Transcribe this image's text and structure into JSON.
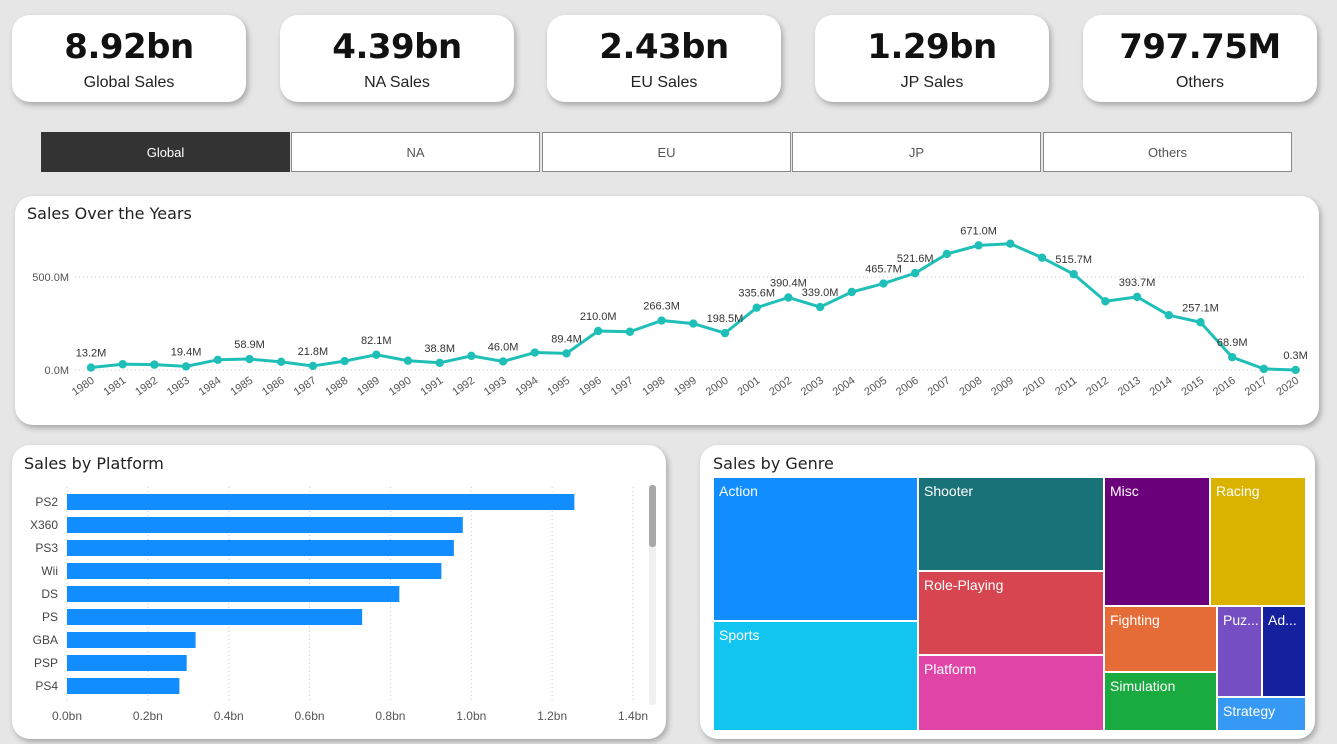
{
  "kpis": [
    {
      "value": "8.92bn",
      "label": "Global Sales"
    },
    {
      "value": "4.39bn",
      "label": "NA Sales"
    },
    {
      "value": "2.43bn",
      "label": "EU Sales"
    },
    {
      "value": "1.29bn",
      "label": "JP Sales"
    },
    {
      "value": "797.75M",
      "label": "Others"
    }
  ],
  "tabs": [
    {
      "label": "Global",
      "active": true
    },
    {
      "label": "NA",
      "active": false
    },
    {
      "label": "EU",
      "active": false
    },
    {
      "label": "JP",
      "active": false
    },
    {
      "label": "Others",
      "active": false
    }
  ],
  "colors": {
    "line": "#1fbfb8",
    "bar": "#118dff",
    "active_tab": "#333333"
  },
  "chart_data": [
    {
      "type": "line",
      "title": "Sales Over the Years",
      "x": [
        "1980",
        "1981",
        "1982",
        "1983",
        "1984",
        "1985",
        "1986",
        "1987",
        "1988",
        "1989",
        "1990",
        "1991",
        "1992",
        "1993",
        "1994",
        "1995",
        "1996",
        "1997",
        "1998",
        "1999",
        "2000",
        "2001",
        "2002",
        "2003",
        "2004",
        "2005",
        "2006",
        "2007",
        "2008",
        "2009",
        "2010",
        "2011",
        "2012",
        "2013",
        "2014",
        "2015",
        "2016",
        "2017",
        "2020"
      ],
      "values": [
        13.2,
        31,
        28.9,
        19.4,
        55,
        58.9,
        44,
        21.8,
        48,
        82.1,
        50,
        38.8,
        76,
        46.0,
        94,
        89.4,
        210.0,
        206,
        266.3,
        250,
        198.5,
        335.6,
        390.4,
        339.0,
        420,
        465.7,
        521.6,
        625,
        671.0,
        680,
        605,
        515.7,
        370,
        393.7,
        295,
        257.1,
        68.9,
        6,
        0.3
      ],
      "data_labels": [
        {
          "x": "1980",
          "text": "13.2M"
        },
        {
          "x": "1983",
          "text": "19.4M"
        },
        {
          "x": "1985",
          "text": "58.9M"
        },
        {
          "x": "1987",
          "text": "21.8M"
        },
        {
          "x": "1989",
          "text": "82.1M"
        },
        {
          "x": "1991",
          "text": "38.8M"
        },
        {
          "x": "1993",
          "text": "46.0M"
        },
        {
          "x": "1995",
          "text": "89.4M"
        },
        {
          "x": "1996",
          "text": "210.0M"
        },
        {
          "x": "1998",
          "text": "266.3M"
        },
        {
          "x": "2000",
          "text": "198.5M"
        },
        {
          "x": "2001",
          "text": "335.6M"
        },
        {
          "x": "2002",
          "text": "390.4M"
        },
        {
          "x": "2003",
          "text": "339.0M"
        },
        {
          "x": "2005",
          "text": "465.7M"
        },
        {
          "x": "2006",
          "text": "521.6M"
        },
        {
          "x": "2008",
          "text": "671.0M"
        },
        {
          "x": "2011",
          "text": "515.7M"
        },
        {
          "x": "2013",
          "text": "393.7M"
        },
        {
          "x": "2015",
          "text": "257.1M"
        },
        {
          "x": "2016",
          "text": "68.9M"
        },
        {
          "x": "2020",
          "text": "0.3M"
        }
      ],
      "ylim": [
        0,
        700
      ],
      "yticks": [
        {
          "value": 0,
          "label": "0.0M"
        },
        {
          "value": 500,
          "label": "500.0M"
        }
      ],
      "grid": true
    },
    {
      "type": "bar",
      "orientation": "horizontal",
      "title": "Sales by Platform",
      "categories": [
        "PS2",
        "X360",
        "PS3",
        "Wii",
        "DS",
        "PS",
        "GBA",
        "PSP",
        "PS4"
      ],
      "values": [
        1.255,
        0.979,
        0.957,
        0.926,
        0.822,
        0.73,
        0.318,
        0.296,
        0.278
      ],
      "xlim": [
        0,
        1.4
      ],
      "xticks": [
        "0.0bn",
        "0.2bn",
        "0.4bn",
        "0.6bn",
        "0.8bn",
        "1.0bn",
        "1.2bn",
        "1.4bn"
      ],
      "grid": true
    },
    {
      "type": "treemap",
      "title": "Sales by Genre",
      "items": [
        {
          "label": "Action",
          "color": "#118dff"
        },
        {
          "label": "Sports",
          "color": "#12c5f0"
        },
        {
          "label": "Shooter",
          "color": "#197278"
        },
        {
          "label": "Role-Playing",
          "color": "#d64550"
        },
        {
          "label": "Platform",
          "color": "#e044a7"
        },
        {
          "label": "Misc",
          "color": "#6b007b"
        },
        {
          "label": "Racing",
          "color": "#d9b300"
        },
        {
          "label": "Fighting",
          "color": "#e66c37"
        },
        {
          "label": "Simulation",
          "color": "#1aab40"
        },
        {
          "label": "Puz...",
          "color": "#744ec2"
        },
        {
          "label": "Ad...",
          "color": "#15209e"
        },
        {
          "label": "Strategy",
          "color": "#3599f5"
        }
      ]
    }
  ]
}
